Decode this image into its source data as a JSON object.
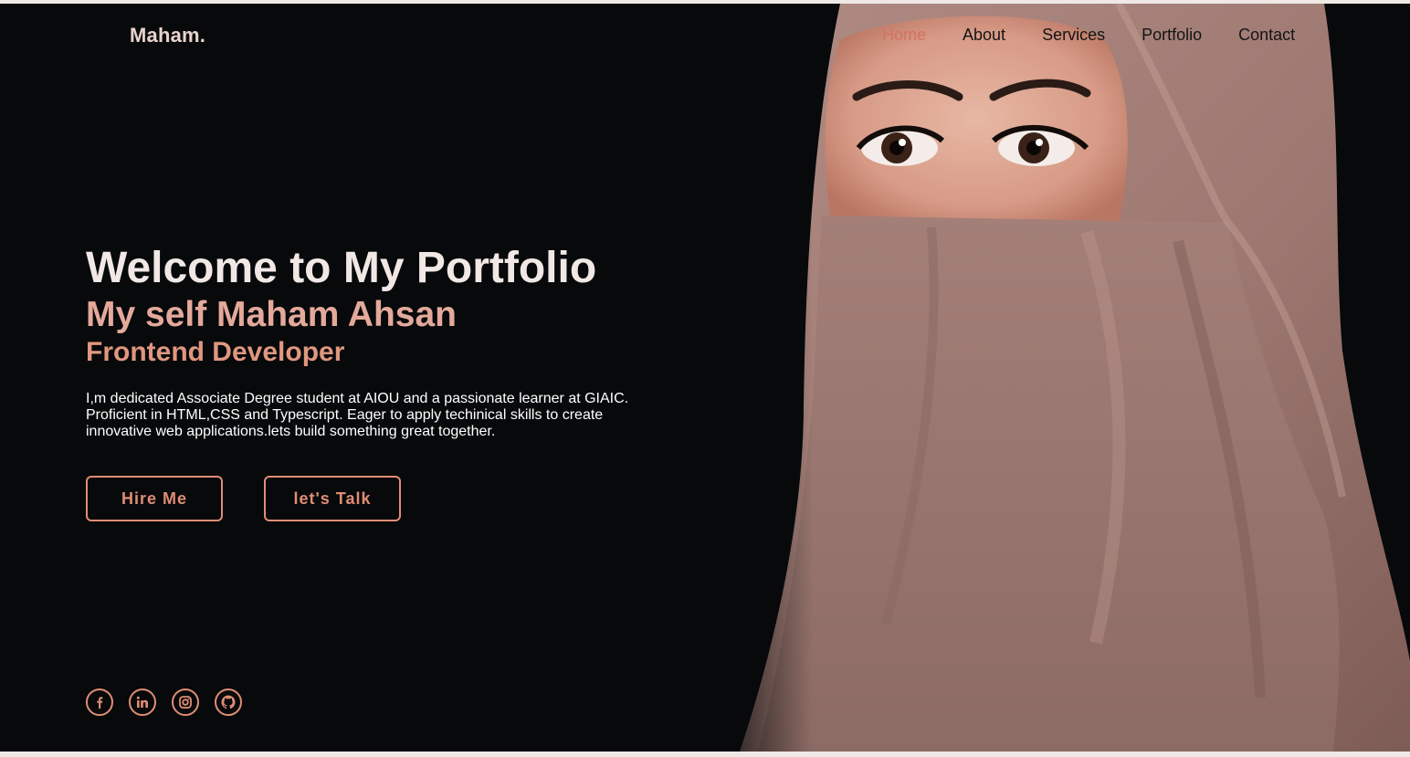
{
  "brand": {
    "logo": "Maham."
  },
  "nav": {
    "items": [
      {
        "label": "Home",
        "active": true
      },
      {
        "label": "About",
        "active": false
      },
      {
        "label": "Services",
        "active": false
      },
      {
        "label": "Portfolio",
        "active": false
      },
      {
        "label": "Contact",
        "active": false
      }
    ]
  },
  "hero": {
    "title": "Welcome to My Portfolio",
    "name_line": "My self Maham Ahsan",
    "role": "Frontend Developer",
    "description": "I,m dedicated Associate Degree student at AIOU and a passionate learner at GIAIC. Proficient in HTML,CSS and Typescript. Eager to apply techinical skills to create innovative web applications.lets build something great together.",
    "buttons": {
      "hire": "Hire Me",
      "talk": "let's Talk"
    },
    "image": "woman-in-hijab-portrait"
  },
  "socials": [
    "facebook-icon",
    "linkedin-icon",
    "instagram-icon",
    "github-icon"
  ],
  "colors": {
    "background": "#07090b",
    "accent": "#e08d74",
    "nav_active": "#d5735d",
    "heading": "#f1e8e5",
    "subheading": "#e4a99a",
    "fabric": "#a98079"
  }
}
